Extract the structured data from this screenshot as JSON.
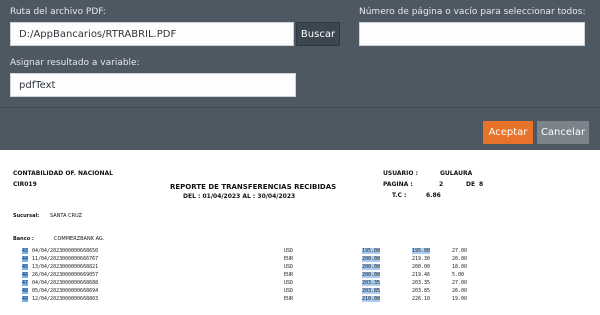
{
  "dialog": {
    "path_label": "Ruta del archivo PDF:",
    "path_value": "D:/AppBancarios/RTRABRIL.PDF",
    "browse_label": "Buscar",
    "page_label": "Número de página o vacío para seleccionar todos:",
    "page_value": "",
    "assign_label": "Asignar resultado a variable:",
    "assign_value": "pdfText",
    "accept_label": "Aceptar",
    "cancel_label": "Cancelar",
    "colors": {
      "accept": "#e8722a",
      "cancel": "#7b838b",
      "panel": "#4d5863"
    }
  },
  "report": {
    "org": "CONTABILIDAD OF. NACIONAL",
    "code": "CIR019",
    "title": "REPORTE DE TRANSFERENCIAS RECIBIDAS",
    "period": "DEL : 01/04/2023   AL :  30/04/2023",
    "user_label": "USUARIO :",
    "user_value": "GULAURA",
    "page_label": "PAGINA :",
    "page_num": "2",
    "page_of_label": "DE",
    "page_total": "8",
    "tc_label": "T.C :",
    "tc_value": "6.86",
    "branch_label": "Sucursal:",
    "branch_value": "SANTA CRUZ",
    "bank_label": "Banco :",
    "bank_value": "COMMERZBANK AG.",
    "rows": [
      {
        "n": "43",
        "date": "04/04/2023",
        "ref": "000000668650",
        "cur": "USD",
        "amt": "195.00",
        "conv": "195.00",
        "fee": "27.00"
      },
      {
        "n": "44",
        "date": "11/04/2023",
        "ref": "000000666767",
        "cur": "EUR",
        "amt": "200.00",
        "conv": "219.30",
        "fee": "20.00"
      },
      {
        "n": "45",
        "date": "13/04/2023",
        "ref": "000000668821",
        "cur": "USD",
        "amt": "200.00",
        "conv": "200.00",
        "fee": "18.00"
      },
      {
        "n": "46",
        "date": "26/04/2023",
        "ref": "000000669057",
        "cur": "EUR",
        "amt": "200.00",
        "conv": "219.46",
        "fee": "5.00"
      },
      {
        "n": "47",
        "date": "04/04/2023",
        "ref": "000000668688",
        "cur": "USD",
        "amt": "203.35",
        "conv": "203.35",
        "fee": "27.00"
      },
      {
        "n": "48",
        "date": "05/04/2023",
        "ref": "000000668694",
        "cur": "USD",
        "amt": "203.85",
        "conv": "203.85",
        "fee": "26.00"
      },
      {
        "n": "49",
        "date": "12/04/2023",
        "ref": "000000668803",
        "cur": "EUR",
        "amt": "210.00",
        "conv": "226.10",
        "fee": "19.00"
      }
    ]
  }
}
